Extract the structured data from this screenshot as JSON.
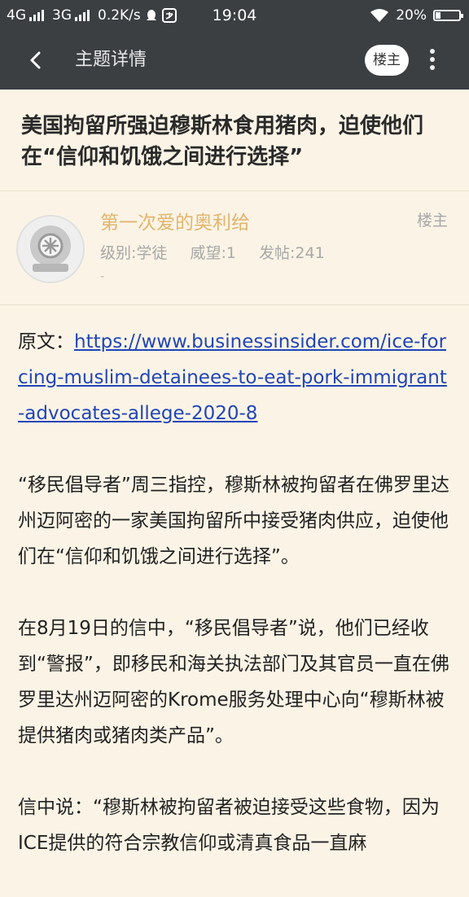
{
  "status_bar": {
    "network1": "4G",
    "network2": "3G",
    "speed": "0.2K/s",
    "time": "19:04",
    "battery": "20%",
    "battery_level": 0.2
  },
  "nav": {
    "title": "主题详情",
    "louzhu_button": "楼主"
  },
  "topic": {
    "title": "美国拘留所强迫穆斯林食用猪肉，迫使他们在“信仰和饥饿之间进行选择”"
  },
  "author": {
    "name": "第一次爱的奥利给",
    "role": "楼主",
    "level": "级别:学徒",
    "prestige": "威望:1",
    "posts": "发帖:241",
    "extra": "-"
  },
  "content": {
    "source_label": "原文：",
    "source_url": "https://www.businessinsider.com/ice-forcing-muslim-detainees-to-eat-pork-immigrant-advocates-allege-2020-8",
    "para1": "“移民倡导者”周三指控，穆斯林被拘留者在佛罗里达州迈阿密的一家美国拘留所中接受猪肉供应，迫使他们在“信仰和饥饿之间进行选择”。",
    "para2": "在8月19日的信中，“移民倡导者”说，他们已经收到“警报”，即移民和海关执法部门及其官员一直在佛罗里达州迈阿密的Krome服务处理中心向“穆斯林被提供猪肉或猪肉类产品”。",
    "para3": "信中说：“穆斯林被拘留者被迫接受这些食物，因为ICE提供的符合宗教信仰或清真食品一直麻"
  },
  "colors": {
    "bar": "#3b3f42",
    "background": "#fbf4e6",
    "author_name": "#e1b56c",
    "link": "#2145b8"
  }
}
